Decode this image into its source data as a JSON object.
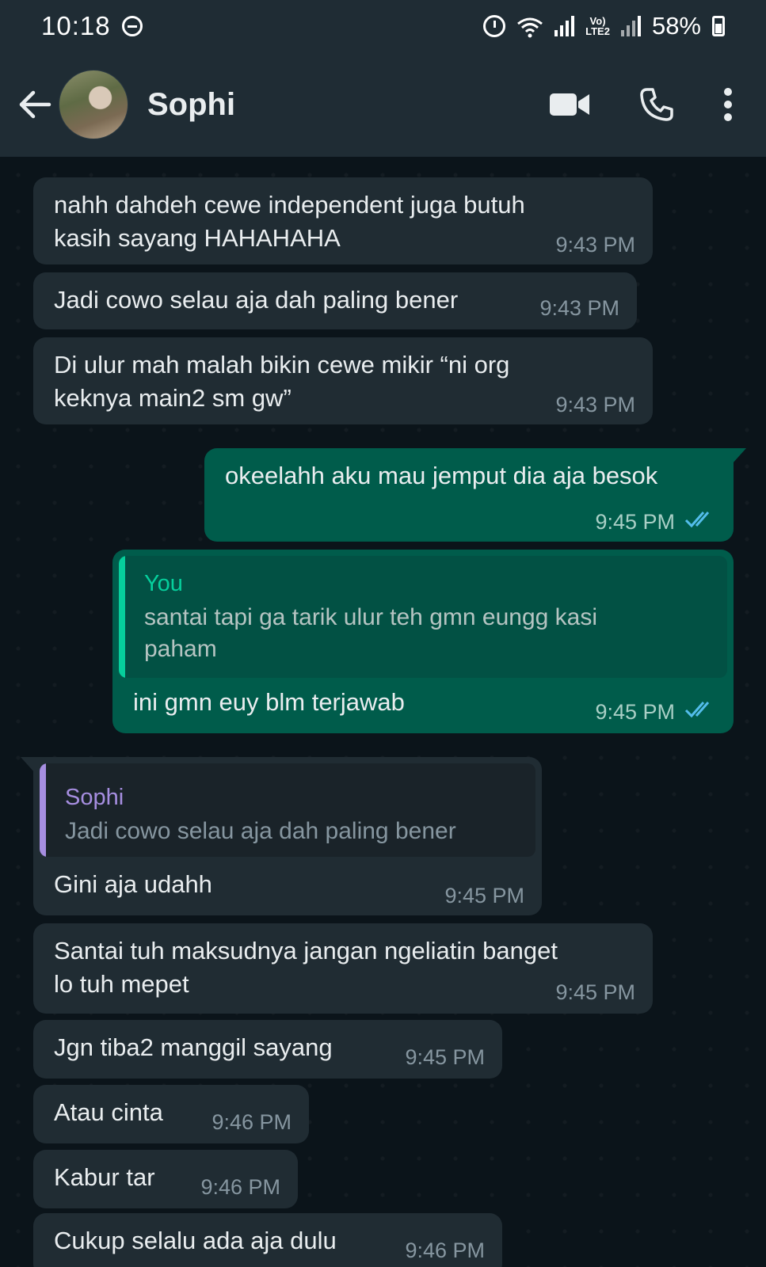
{
  "status_bar": {
    "time": "10:18",
    "network": "LTE2",
    "battery": "58%",
    "icons": [
      "dnd-icon",
      "alarm-icon",
      "wifi-icon",
      "signal-icon",
      "volte-icon",
      "battery-icon"
    ]
  },
  "header": {
    "contact_name": "Sophi",
    "icons": [
      "back-arrow-icon",
      "avatar",
      "video-call-icon",
      "voice-call-icon",
      "more-options-icon"
    ]
  },
  "colors": {
    "incoming_bubble": "#202c33",
    "outgoing_bubble": "#005c4b",
    "read_ticks": "#53bdeb",
    "quote_you": "#06cf9c",
    "quote_sophi": "#a68ee0"
  },
  "messages": [
    {
      "line1": "nahh dahdeh cewe independent juga butuh",
      "line2": "kasih sayang HAHAHAHA",
      "time": "9:43 PM"
    },
    {
      "text": "Jadi cowo selau aja dah paling bener",
      "time": "9:43 PM"
    },
    {
      "line1": "Di ulur mah malah bikin cewe mikir “ni org",
      "line2": "keknya main2 sm gw”",
      "time": "9:43 PM"
    },
    {
      "text": "okeelahh aku mau jemput dia aja besok",
      "time": "9:45 PM"
    },
    {
      "quote_author": "You",
      "quote_line1": "santai tapi ga tarik ulur teh gmn eungg kasi",
      "quote_line2": "paham",
      "text": "ini gmn euy blm terjawab",
      "time": "9:45 PM"
    },
    {
      "quote_author": "Sophi",
      "quote_text": "Jadi cowo selau aja dah paling bener",
      "text": "Gini aja udahh",
      "time": "9:45 PM"
    },
    {
      "line1": "Santai tuh maksudnya jangan ngeliatin banget",
      "line2": "lo tuh mepet",
      "time": "9:45 PM"
    },
    {
      "text": "Jgn tiba2 manggil sayang",
      "time": "9:45 PM"
    },
    {
      "text": "Atau cinta",
      "time": "9:46 PM"
    },
    {
      "text": "Kabur tar",
      "time": "9:46 PM"
    },
    {
      "text": "Cukup selalu ada aja dulu",
      "time": "9:46 PM"
    }
  ]
}
